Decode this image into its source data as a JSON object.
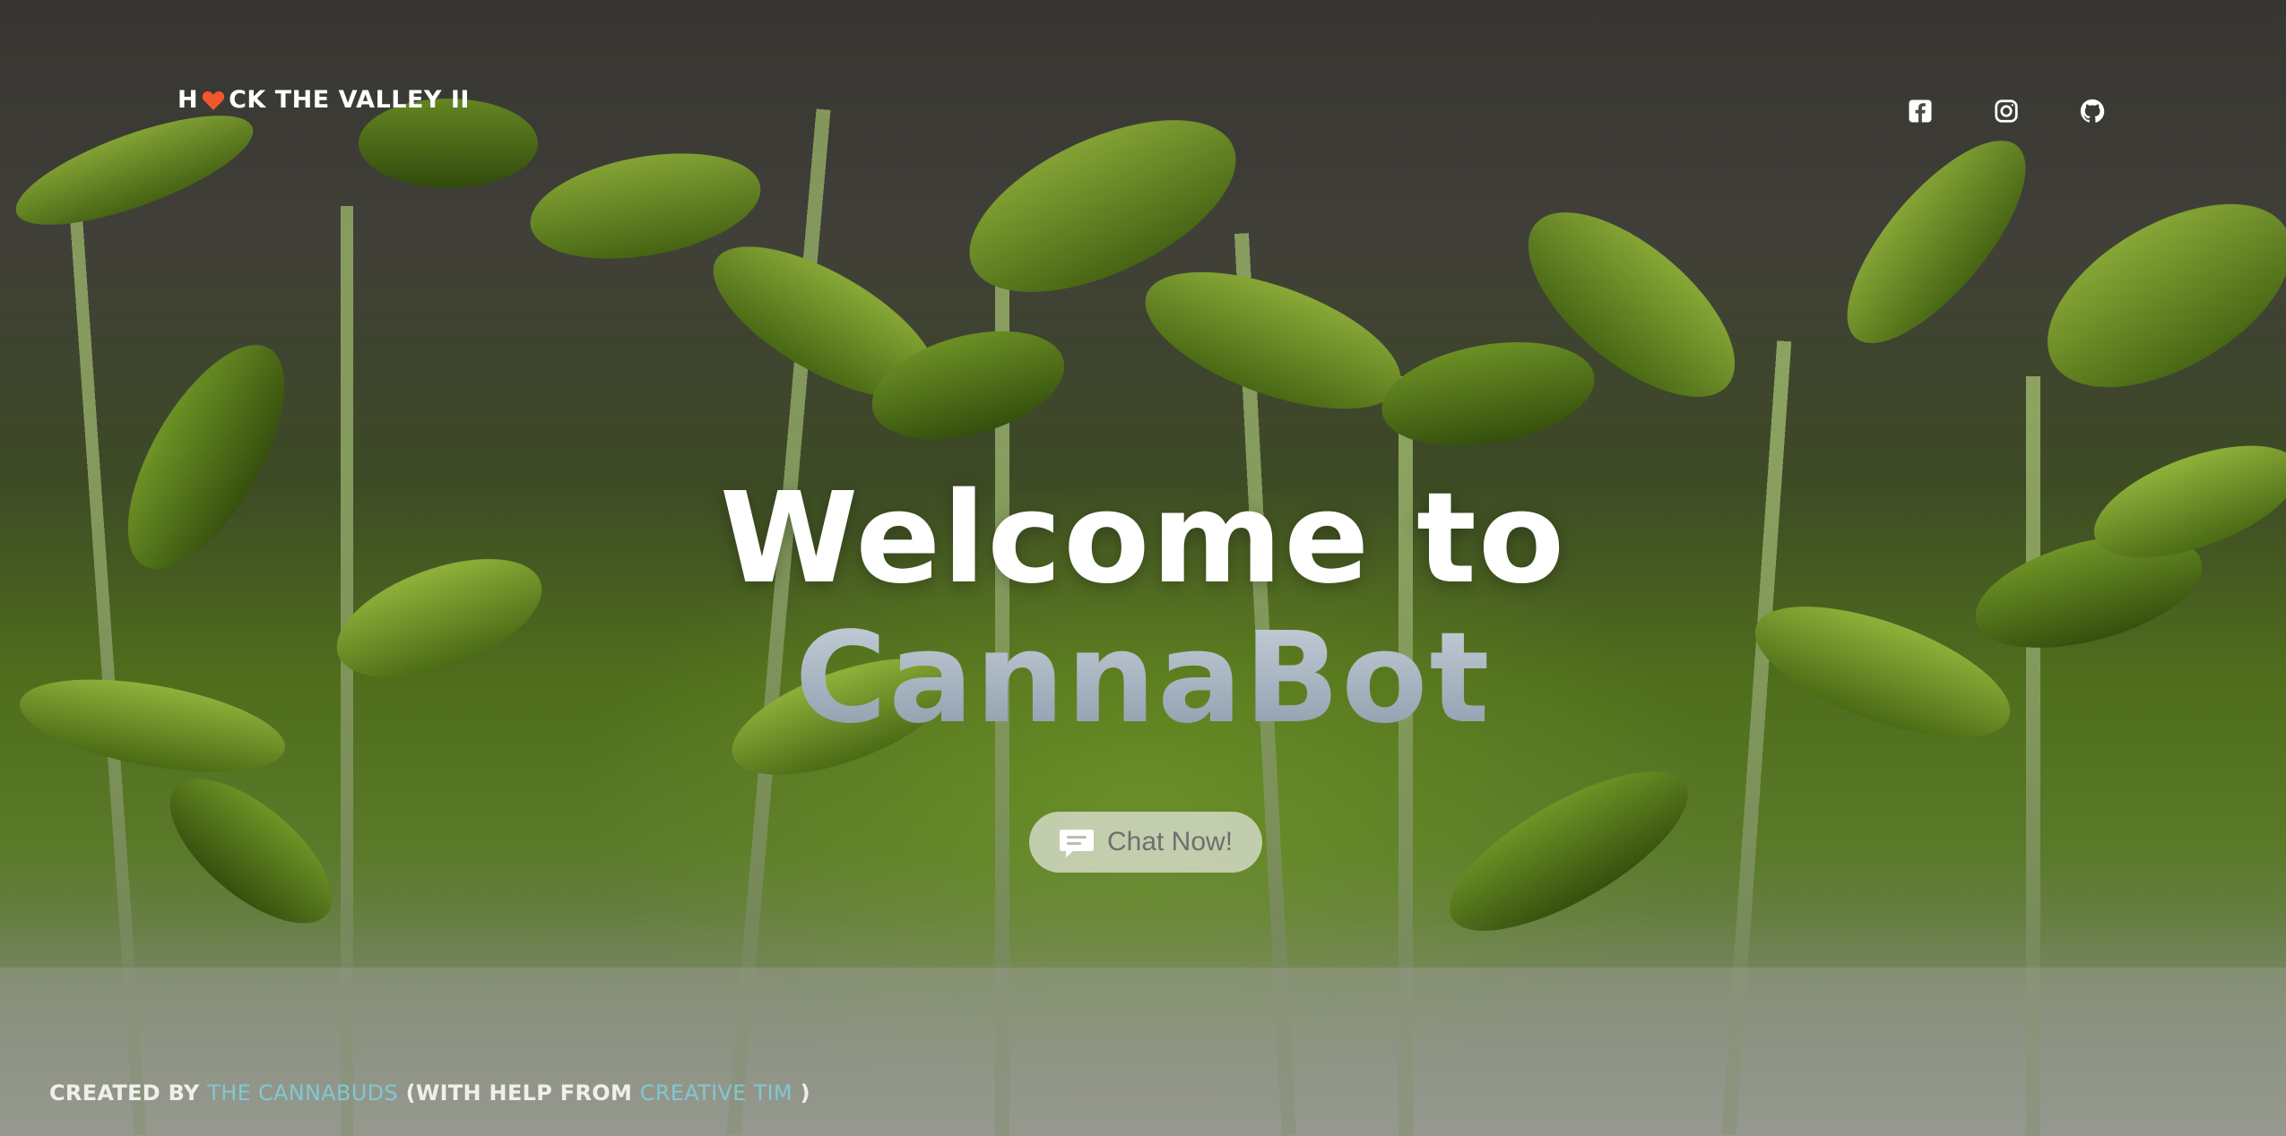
{
  "brand": {
    "prefix": "H",
    "suffix": "CK THE VALLEY II",
    "accent": "#f0582b"
  },
  "social": [
    {
      "name": "facebook-icon"
    },
    {
      "name": "instagram-icon"
    },
    {
      "name": "github-icon"
    }
  ],
  "hero": {
    "title_line1": "Welcome to",
    "title_line2": "CannaBot"
  },
  "cta": {
    "label": "Chat Now!",
    "icon": "chat-bubble-icon"
  },
  "footer": {
    "created_by": "CREATED BY",
    "team_link": "THE CANNABUDS",
    "with_help": "(WITH HELP FROM",
    "help_link": "CREATIVE TIM",
    "close": ")"
  },
  "colors": {
    "link": "#7fc8d4",
    "heart": "#f0582b"
  }
}
